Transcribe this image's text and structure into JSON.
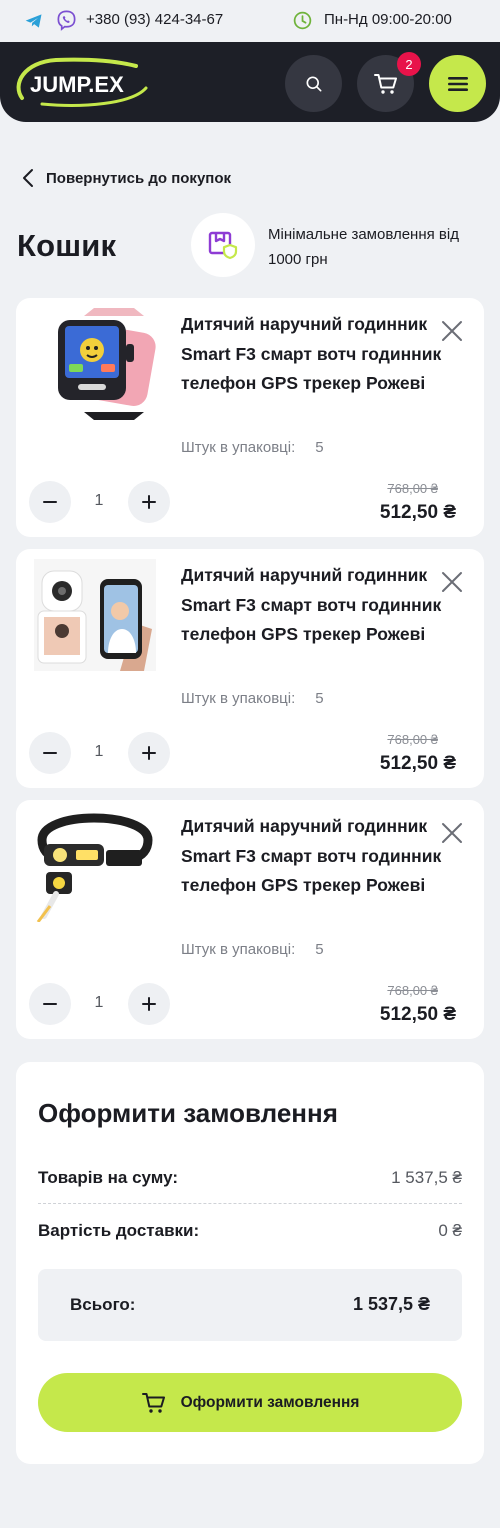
{
  "topbar": {
    "phone": "+380 (93) 424-34-67",
    "hours": "Пн-Нд 09:00-20:00"
  },
  "header": {
    "logo_text": "JUMP.EX",
    "cart_count": "2"
  },
  "nav": {
    "back_label": "Повернутись до покупок"
  },
  "page": {
    "title": "Кошик",
    "min_order": "Мінімальне замовлення від 1000 грн"
  },
  "cart": {
    "items": [
      {
        "title": "Дитячий наручний годинник Smart F3 смарт вотч годинник телефон GPS трекер Рожеві",
        "pack_label": "Штук в упаковці:",
        "pack_value": "5",
        "quantity": "1",
        "old_price": "768,00 ₴",
        "price": "512,50 ₴"
      },
      {
        "title": "Дитячий наручний годинник Smart F3 смарт вотч годинник телефон GPS трекер Рожеві",
        "pack_label": "Штук в упаковці:",
        "pack_value": "5",
        "quantity": "1",
        "old_price": "768,00 ₴",
        "price": "512,50 ₴"
      },
      {
        "title": "Дитячий наручний годинник Smart F3 смарт вотч годинник телефон GPS трекер Рожеві",
        "pack_label": "Штук в упаковці:",
        "pack_value": "5",
        "quantity": "1",
        "old_price": "768,00 ₴",
        "price": "512,50 ₴"
      }
    ]
  },
  "summary": {
    "title": "Оформити замовлення",
    "goods_label": "Товарів на суму:",
    "goods_value": "1 537,5 ₴",
    "delivery_label": "Вартість доставки:",
    "delivery_value": "0 ₴",
    "total_label": "Всього:",
    "total_value": "1 537,5 ₴",
    "checkout_label": "Оформити замовлення"
  },
  "colors": {
    "accent": "#c5e84b",
    "header_bg": "#1d1f27",
    "badge": "#e8134a",
    "page_bg": "#eff1f4"
  },
  "icons": [
    "telegram-icon",
    "viber-icon",
    "clock-icon",
    "search-icon",
    "cart-icon",
    "menu-icon",
    "chevron-left-icon",
    "package-shield-icon",
    "close-icon",
    "minus-icon",
    "plus-icon"
  ]
}
